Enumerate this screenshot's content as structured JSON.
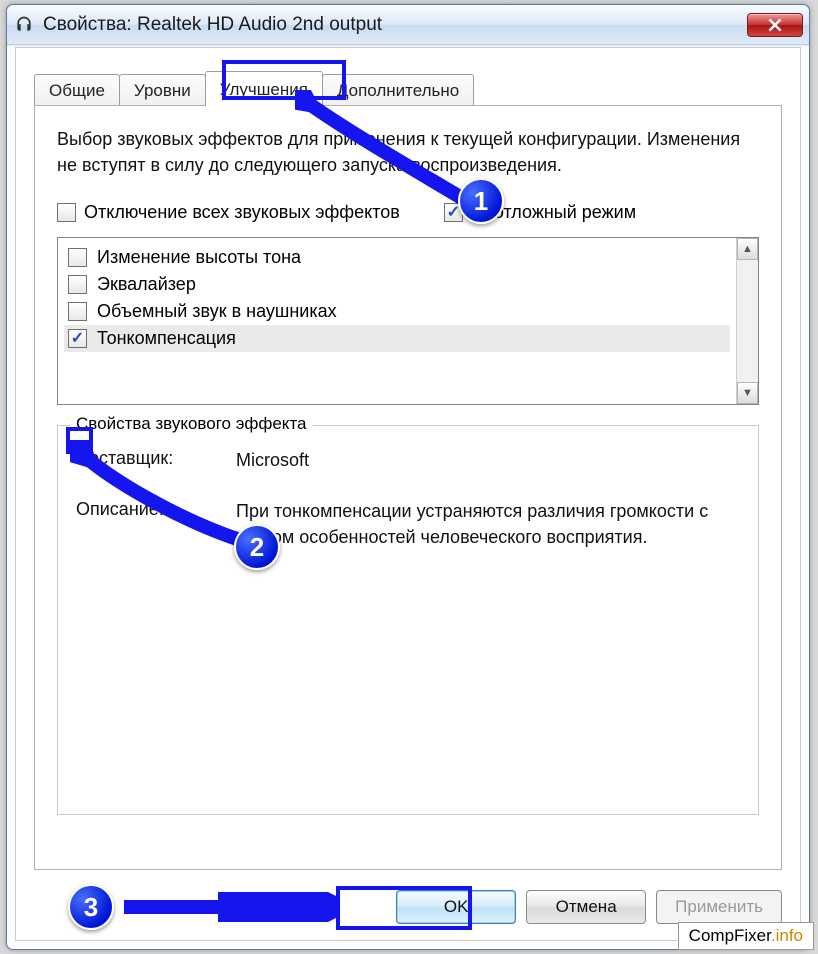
{
  "window": {
    "title": "Свойства: Realtek HD Audio 2nd output"
  },
  "tabs": [
    {
      "label": "Общие"
    },
    {
      "label": "Уровни"
    },
    {
      "label": "Улучшения"
    },
    {
      "label": "Дополнительно"
    }
  ],
  "panel": {
    "description": "Выбор звуковых эффектов для применения к текущей конфигурации. Изменения не вступят в силу до следующего запуска воспроизведения.",
    "disable_all_label": "Отключение всех звуковых эффектов",
    "disable_all_checked": false,
    "immediate_label": "Неотложный режим",
    "immediate_checked": true,
    "effects": [
      {
        "label": "Изменение высоты тона",
        "checked": false
      },
      {
        "label": "Эквалайзер",
        "checked": false
      },
      {
        "label": "Объемный звук в наушниках",
        "checked": false
      },
      {
        "label": "Тонкомпенсация",
        "checked": true,
        "selected": true
      }
    ],
    "group_title": "Свойства звукового эффекта",
    "provider_label": "Поставщик:",
    "provider_value": "Microsoft",
    "description_label": "Описание:",
    "description_value": "При тонкомпенсации устраняются различия громкости с учетом особенностей человеческого восприятия."
  },
  "buttons": {
    "ok": "OK",
    "cancel": "Отмена",
    "apply": "Применить"
  },
  "annotations": {
    "step1": "1",
    "step2": "2",
    "step3": "3"
  },
  "watermark": {
    "part1": "CompFixer",
    "part2": ".info"
  }
}
